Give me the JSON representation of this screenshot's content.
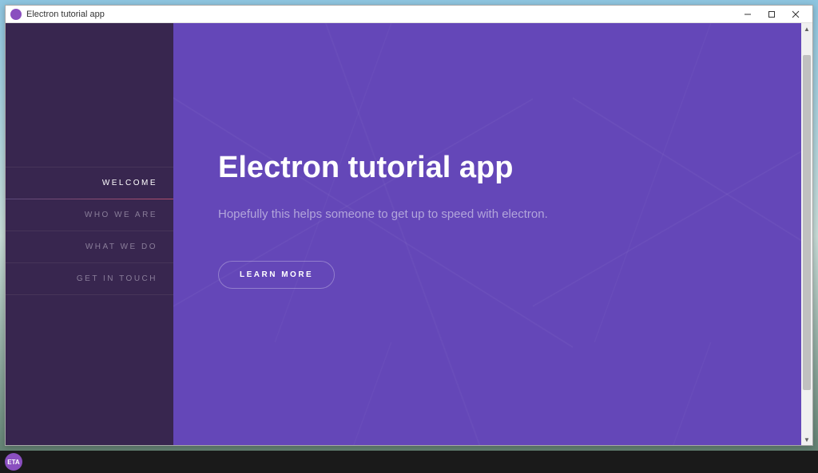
{
  "window": {
    "title": "Electron tutorial app"
  },
  "sidebar": {
    "items": [
      {
        "label": "WELCOME",
        "active": true
      },
      {
        "label": "WHO WE ARE",
        "active": false
      },
      {
        "label": "WHAT WE DO",
        "active": false
      },
      {
        "label": "GET IN TOUCH",
        "active": false
      }
    ]
  },
  "main": {
    "heading": "Electron tutorial app",
    "subtitle": "Hopefully this helps someone to get up to speed with electron.",
    "button_label": "LEARN MORE"
  },
  "colors": {
    "sidebar_bg": "#38264f",
    "main_bg": "#6447b8",
    "accent_gradient_end": "#b3506e"
  }
}
